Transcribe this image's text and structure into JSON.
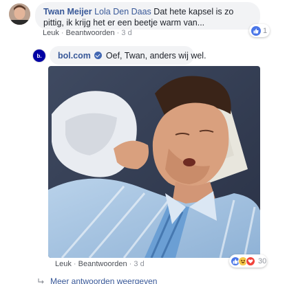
{
  "comment1": {
    "author": "Twan Meijer",
    "mention": "Lola Den Daas",
    "text": "Dat hete kapsel is zo pittig, ik krijg het er een beetje warm van...",
    "like_label": "Leuk",
    "reply_label": "Beantwoorden",
    "time": "3 d",
    "reaction_count": "1"
  },
  "reply": {
    "author": "bol.com",
    "text": "Oef, Twan, anders wij wel.",
    "like_label": "Leuk",
    "reply_label": "Beantwoorden",
    "time": "3 d",
    "reaction_count": "30"
  },
  "more_replies_label": "Meer antwoorden weergeven",
  "colors": {
    "link": "#385898",
    "bubble": "#f2f3f5",
    "meta": "#90949c",
    "like": "#4a76e8",
    "love": "#f0433c"
  },
  "icons": {
    "verified": "verified-badge-icon",
    "like": "like-reaction-icon",
    "haha": "haha-reaction-icon",
    "love": "love-reaction-icon",
    "reply_arrow": "reply-arrow-icon"
  }
}
